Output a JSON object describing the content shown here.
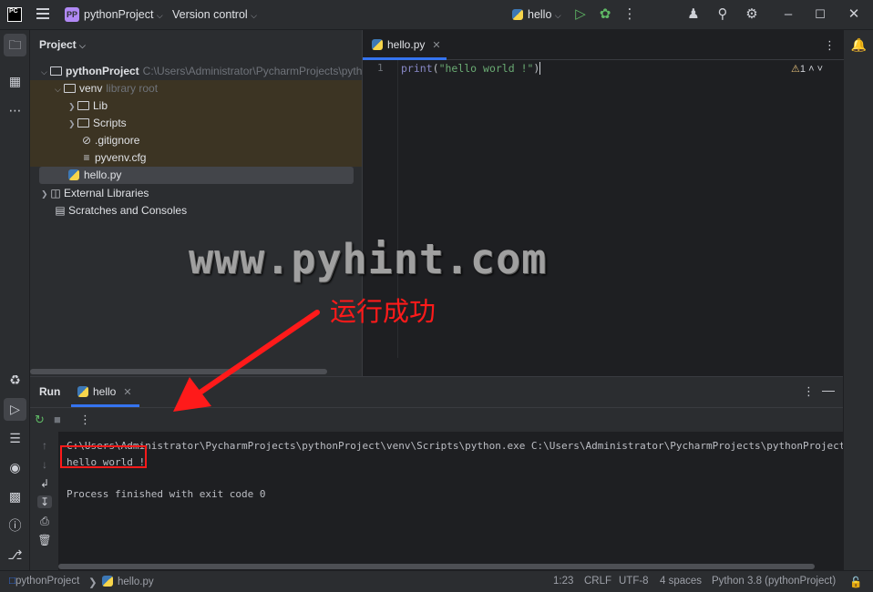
{
  "titlebar": {
    "logo_text": "PC",
    "project_badge": "PP",
    "project_name": "pythonProject",
    "vcs_label": "Version control",
    "run_config": "hello"
  },
  "project_panel": {
    "title": "Project",
    "root": {
      "name": "pythonProject",
      "path": "C:\\Users\\Administrator\\PycharmProjects\\pythonP"
    },
    "venv": {
      "name": "venv",
      "hint": "library root"
    },
    "items": {
      "lib": "Lib",
      "scripts": "Scripts",
      "gitignore": ".gitignore",
      "pyvenv": "pyvenv.cfg",
      "hello": "hello.py",
      "external": "External Libraries",
      "scratches": "Scratches and Consoles"
    }
  },
  "editor": {
    "tab_label": "hello.py",
    "line_number": "1",
    "code": {
      "func": "print",
      "open": "(",
      "string": "\"hello world !\"",
      "close": ")"
    },
    "warnings": "1"
  },
  "watermark": "www.pyhint.com",
  "annotation": "运行成功",
  "run_panel": {
    "title": "Run",
    "tab_label": "hello",
    "command": "C:\\Users\\Administrator\\PycharmProjects\\pythonProject\\venv\\Scripts\\python.exe C:\\Users\\Administrator\\PycharmProjects\\pythonProject\\hello.py",
    "output": "hello world !",
    "exit_message": "Process finished with exit code 0"
  },
  "statusbar": {
    "project": "pythonProject",
    "file": "hello.py",
    "position": "1:23",
    "line_sep": "CRLF",
    "encoding": "UTF-8",
    "indent": "4 spaces",
    "interpreter": "Python 3.8 (pythonProject)"
  },
  "colors": {
    "accent": "#3574f0",
    "annotation_red": "#ff1a1a",
    "string_green": "#6aab73",
    "run_green": "#5fb865"
  }
}
